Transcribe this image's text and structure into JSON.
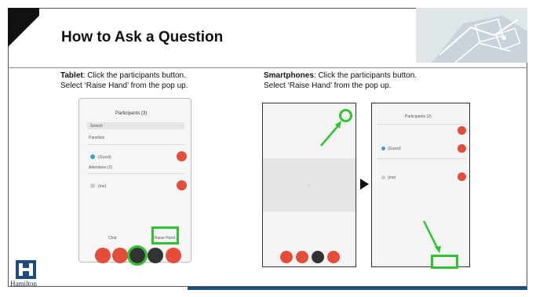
{
  "slide": {
    "title": "How to Ask a Question",
    "tablet": {
      "bold": "Tablet",
      "line1_rest": ": Click the participants button.",
      "line2": "Select ‘Raise Hand’ from the pop up."
    },
    "smartphones": {
      "bold": "Smartphones",
      "line1_rest": ": Click the participants button.",
      "line2": "Select ‘Raise Hand’ from the pop up."
    },
    "tablet_screen": {
      "header": "Participants (3)",
      "search": "Search",
      "section1": "Panelists",
      "p1": "(Guest)",
      "section2": "Attendees (2)",
      "p2": "(me)",
      "chat": "Chat",
      "raise_hand": "Raise Hand"
    },
    "phone_screen": {
      "header": "Participants (2)",
      "p1": "(Guest)",
      "p2": "(me)"
    },
    "logo_text": "Hamilton",
    "colors": {
      "accent_green": "#2ec42e",
      "red_button": "#e44d3a",
      "footer_blue": "#1c4f7a"
    }
  }
}
